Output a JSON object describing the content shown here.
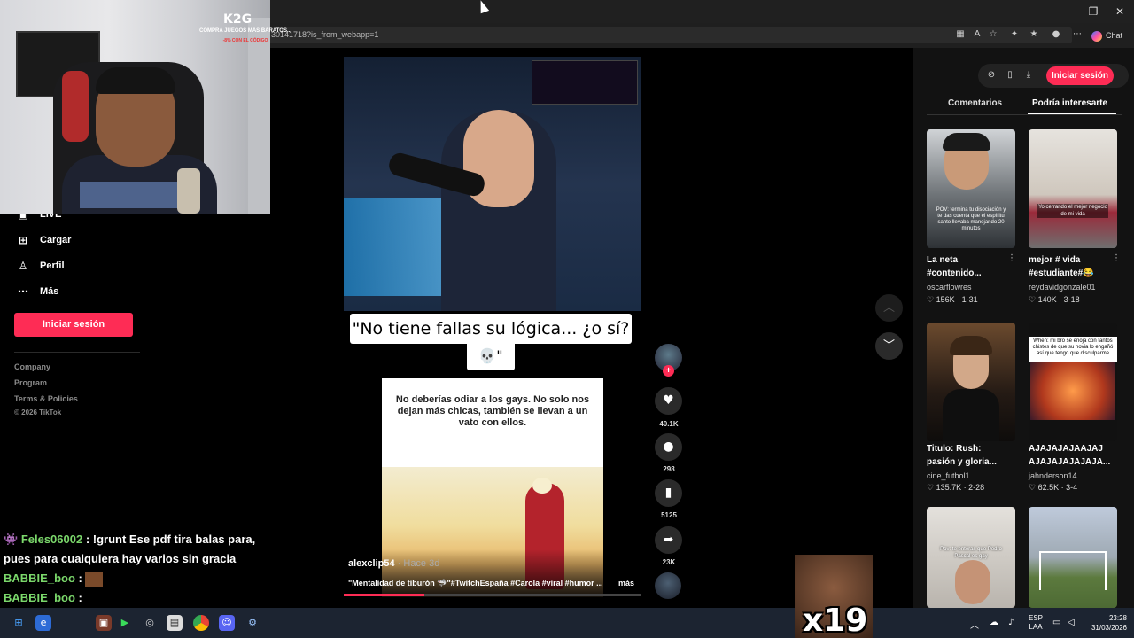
{
  "browser": {
    "url": "30141718?is_from_webapp=1",
    "chat_label": "Chat"
  },
  "sidebar": {
    "items": [
      {
        "label": "LIVE",
        "icon": "live-icon"
      },
      {
        "label": "Cargar",
        "icon": "upload-icon"
      },
      {
        "label": "Perfil",
        "icon": "profile-icon"
      },
      {
        "label": "Más",
        "icon": "more-icon"
      }
    ],
    "login_label": "Iniciar sesión",
    "footer": [
      "Company",
      "Program",
      "Terms & Policies",
      "© 2026 TikTok"
    ]
  },
  "chat": {
    "line1_user": "Feles06002",
    "line1_text": " : !grunt Ese pdf tira balas para, pues para cualquiera hay varios sin gracia",
    "line2_user": "BABBIE_boo",
    "line2_text": " :",
    "line3_user": "BABBIE_boo",
    "line3_text": " :"
  },
  "video": {
    "ad_logo": "K2G",
    "ad_text": "COMPRA JUEGOS MÁS BARATOS...",
    "ad_sub": "-8% CON EL CÓDIGO",
    "caption_line1": "\"No tiene fallas su lógica... ¿o sí?",
    "caption_line2": "💀\"",
    "meme_text": "No deberías odiar a los gays. No solo nos dejan más chicas, también se llevan a un vato con ellos.",
    "author": "alexclip54",
    "author_time": " · Hace 3d",
    "description": "\"Mentalidad de tiburón 🦈\"#TwitchEspaña #Carola #viral #humor ...",
    "more_label": "más",
    "progress": 0.27
  },
  "actions": {
    "likes": "40.1K",
    "comments": "298",
    "saves": "5125",
    "shares": "23K"
  },
  "right_panel": {
    "login_label": "Iniciar sesión",
    "tabs": [
      "Comentarios",
      "Podría interesarte"
    ],
    "recommendations": [
      {
        "title": "La neta #contenido...",
        "user": "oscarflowres",
        "likes": "156K",
        "date": "1-31",
        "thumb_text": "POV: termina tu disociación y te das cuenta que el espíritu santo llevaba manejando 20 minutos"
      },
      {
        "title": "mejor # vida #estudiante#😂",
        "user": "reydavidgonzale01",
        "likes": "140K",
        "date": "3-18",
        "thumb_text": "Yo cerrando el mejor negocio de mi vida"
      },
      {
        "title": "Titulo: Rush: pasión y gloria...",
        "user": "cine_futbol1",
        "likes": "135.7K",
        "date": "2-28",
        "thumb_text": ""
      },
      {
        "title": "AJAJAJAJAAJAJ AJAJAJAJAJAJA...",
        "user": "jahnderson14",
        "likes": "62.5K",
        "date": "3-4",
        "thumb_text": "When: mi bro se enoja con tantos chistes de que su novia lo engañó así que tengo que disculparme"
      },
      {
        "title": "",
        "user": "",
        "likes": "",
        "date": "",
        "thumb_text": "Pov: te enteras que Pedro Pascal es gay"
      },
      {
        "title": "",
        "user": "",
        "likes": "",
        "date": "",
        "thumb_text": ""
      }
    ]
  },
  "taskbar": {
    "lang_top": "ESP",
    "lang_bottom": "LAA",
    "time": "23:28",
    "date": "31/03/2026"
  },
  "emote": {
    "multiplier": "x19"
  },
  "colors": {
    "accent": "#fe2c55",
    "chat_user": "#7bd86b"
  }
}
